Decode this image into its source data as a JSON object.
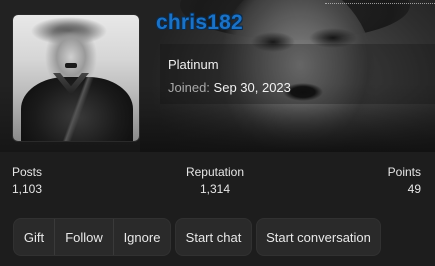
{
  "profile": {
    "username": "chris182",
    "title": "Platinum",
    "joined_label": "Joined:",
    "joined_date": "Sep 30, 2023"
  },
  "stats": {
    "posts": {
      "label": "Posts",
      "value": "1,103"
    },
    "reputation": {
      "label": "Reputation",
      "value": "1,314"
    },
    "points": {
      "label": "Points",
      "value": "49"
    }
  },
  "actions": {
    "gift": "Gift",
    "follow": "Follow",
    "ignore": "Ignore",
    "start_chat": "Start chat",
    "start_conversation": "Start conversation"
  },
  "colors": {
    "username": "#1b72c6",
    "background": "#1d1d1d",
    "button": "#2a2a2a"
  }
}
